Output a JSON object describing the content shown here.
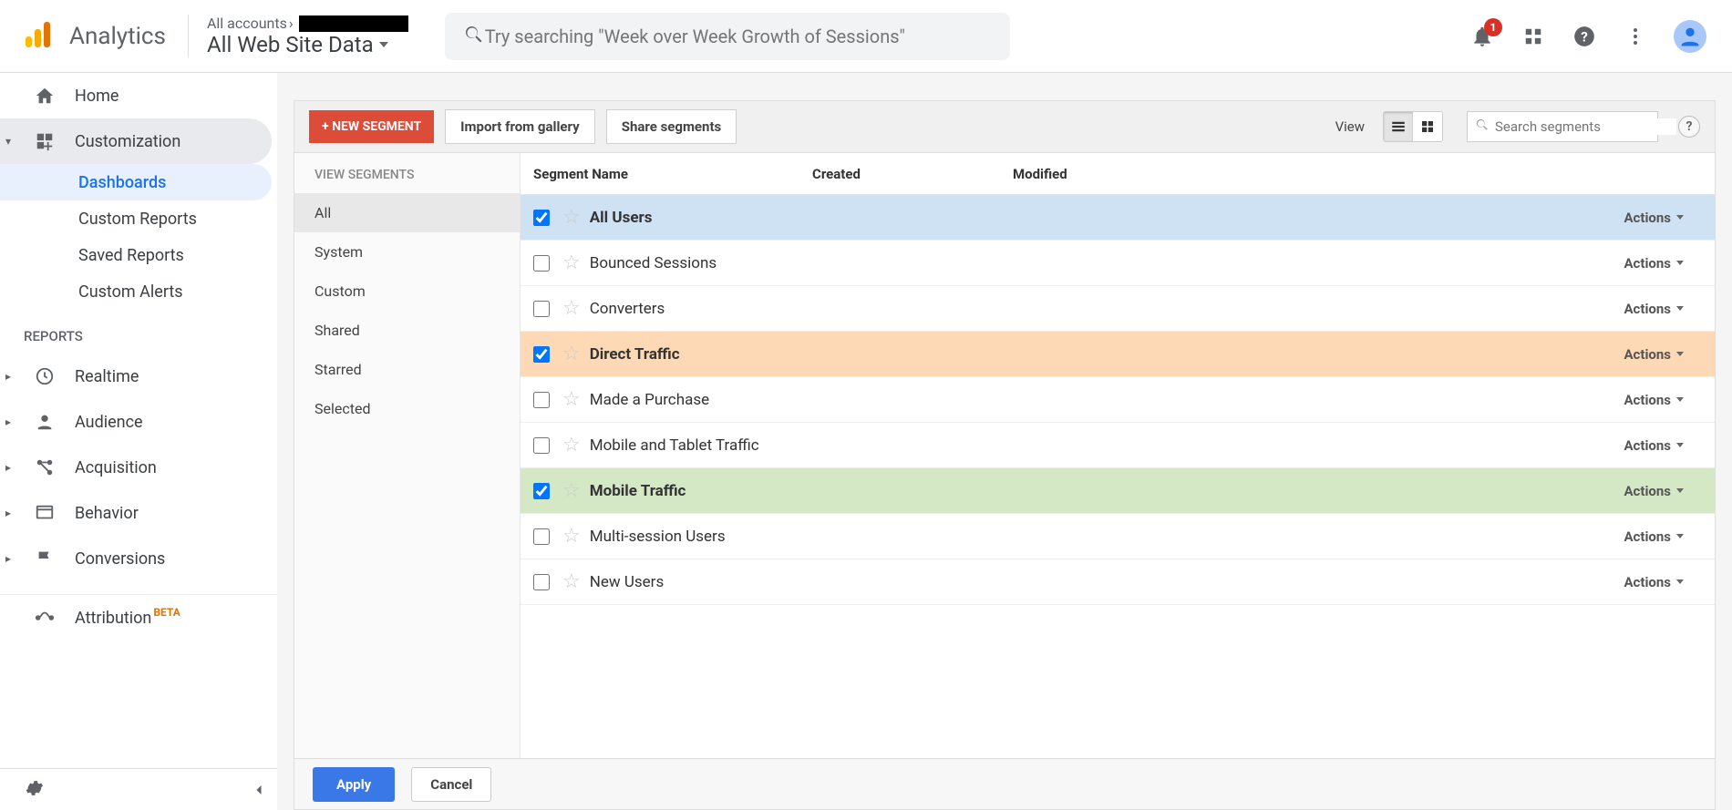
{
  "header": {
    "product": "Analytics",
    "breadcrumb": "All accounts",
    "view": "All Web Site Data",
    "search_placeholder": "Try searching \"Week over Week Growth of Sessions\"",
    "notification_count": "1"
  },
  "sidebar": {
    "home": "Home",
    "customization": "Customization",
    "sub": {
      "dashboards": "Dashboards",
      "custom_reports": "Custom Reports",
      "saved_reports": "Saved Reports",
      "custom_alerts": "Custom Alerts"
    },
    "reports_label": "REPORTS",
    "realtime": "Realtime",
    "audience": "Audience",
    "acquisition": "Acquisition",
    "behavior": "Behavior",
    "conversions": "Conversions",
    "attribution": "Attribution",
    "attribution_badge": "BETA"
  },
  "toolbar": {
    "new_segment": "+ NEW SEGMENT",
    "import": "Import from gallery",
    "share": "Share segments",
    "view_label": "View",
    "search_placeholder": "Search segments",
    "help": "?"
  },
  "filters": {
    "title": "VIEW SEGMENTS",
    "items": [
      "All",
      "System",
      "Custom",
      "Shared",
      "Starred",
      "Selected"
    ]
  },
  "columns": {
    "name": "Segment Name",
    "created": "Created",
    "modified": "Modified"
  },
  "actions_label": "Actions",
  "segments": [
    {
      "name": "All Users",
      "checked": true,
      "color": "blue"
    },
    {
      "name": "Bounced Sessions",
      "checked": false,
      "color": ""
    },
    {
      "name": "Converters",
      "checked": false,
      "color": ""
    },
    {
      "name": "Direct Traffic",
      "checked": true,
      "color": "orange"
    },
    {
      "name": "Made a Purchase",
      "checked": false,
      "color": ""
    },
    {
      "name": "Mobile and Tablet Traffic",
      "checked": false,
      "color": ""
    },
    {
      "name": "Mobile Traffic",
      "checked": true,
      "color": "green"
    },
    {
      "name": "Multi-session Users",
      "checked": false,
      "color": ""
    },
    {
      "name": "New Users",
      "checked": false,
      "color": ""
    }
  ],
  "footer": {
    "apply": "Apply",
    "cancel": "Cancel"
  }
}
